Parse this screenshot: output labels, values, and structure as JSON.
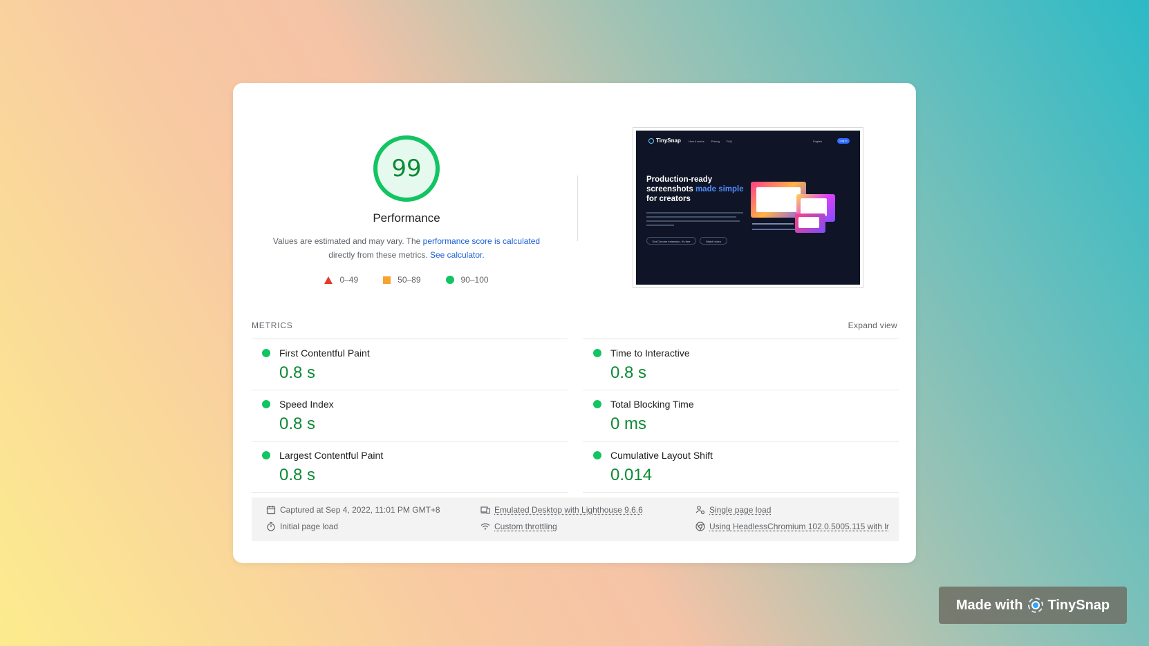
{
  "performance": {
    "score": "99",
    "score_fraction": 0.99,
    "title": "Performance",
    "desc_pre": "Values are estimated and may vary. The ",
    "desc_link1": "performance score is calculated",
    "desc_mid": " directly from these metrics. ",
    "desc_link2": "See calculator.",
    "legend": [
      {
        "icon": "triangle-red-icon",
        "label": "0–49"
      },
      {
        "icon": "square-orange-icon",
        "label": "50–89"
      },
      {
        "icon": "circle-green-icon",
        "label": "90–100"
      }
    ],
    "colors": {
      "pass": "#0c8a34",
      "pass_bg": "#e6f9ee",
      "pass_ring": "#12c462"
    }
  },
  "thumbnail": {
    "logo": "TinySnap",
    "nav": [
      "How it works",
      "Pricing",
      "FAQ"
    ],
    "lang": "English",
    "login": "Log in",
    "hero_1": "Production-ready",
    "hero_2a": "screenshots ",
    "hero_2b": "made simple",
    "hero_3": "for creators",
    "btn_primary": "Get Chrome extension, it's free",
    "btn_secondary": "Watch video"
  },
  "metrics": {
    "title": "METRICS",
    "expand": "Expand view",
    "left": [
      {
        "label": "First Contentful Paint",
        "value": "0.8 s"
      },
      {
        "label": "Speed Index",
        "value": "0.8 s"
      },
      {
        "label": "Largest Contentful Paint",
        "value": "0.8 s"
      }
    ],
    "right": [
      {
        "label": "Time to Interactive",
        "value": "0.8 s"
      },
      {
        "label": "Total Blocking Time",
        "value": "0 ms"
      },
      {
        "label": "Cumulative Layout Shift",
        "value": "0.014"
      }
    ]
  },
  "footer": {
    "captured": "Captured at Sep 4, 2022, 11:01 PM GMT+8",
    "initial": "Initial page load",
    "emulated": "Emulated Desktop with Lighthouse 9.6.6",
    "throttling": "Custom throttling",
    "single": "Single page load",
    "browser": "Using HeadlessChromium 102.0.5005.115 with lr"
  },
  "badge": {
    "text_pre": "Made with",
    "text_brand": "TinySnap"
  }
}
